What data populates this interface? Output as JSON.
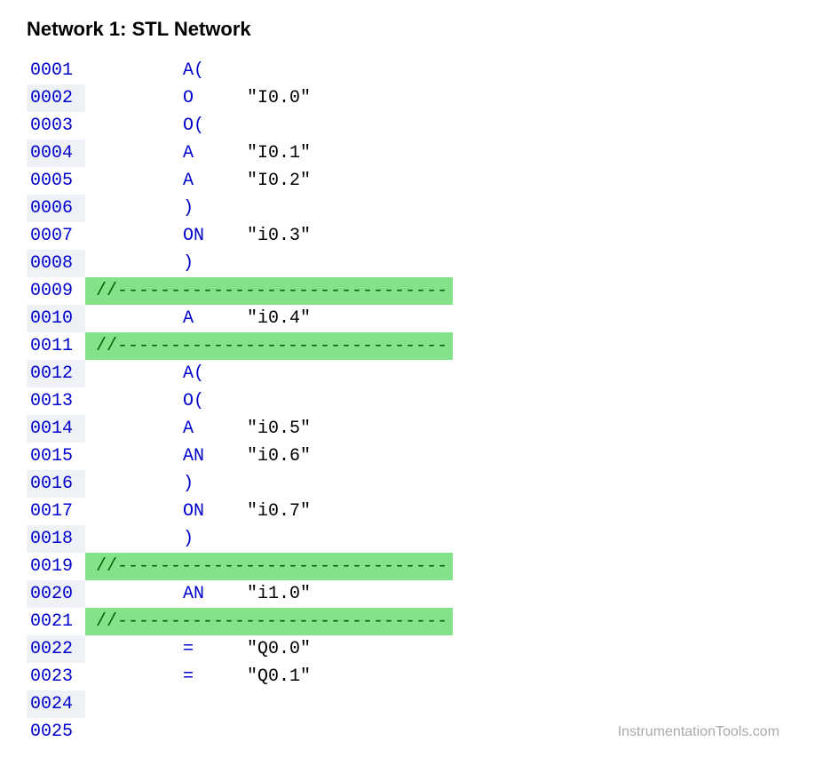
{
  "title": "Network 1: STL Network",
  "watermark": "InstrumentationTools.com",
  "comment_sep": "//-------------------------------",
  "lines": [
    {
      "n": "0001",
      "type": "code",
      "op": "A(",
      "arg": ""
    },
    {
      "n": "0002",
      "type": "code",
      "op": "O",
      "arg": "\"I0.0\""
    },
    {
      "n": "0003",
      "type": "code",
      "op": "O(",
      "arg": ""
    },
    {
      "n": "0004",
      "type": "code",
      "op": "A",
      "arg": "\"I0.1\""
    },
    {
      "n": "0005",
      "type": "code",
      "op": "A",
      "arg": "\"I0.2\""
    },
    {
      "n": "0006",
      "type": "code",
      "op": ")",
      "arg": ""
    },
    {
      "n": "0007",
      "type": "code",
      "op": "ON",
      "arg": "\"i0.3\""
    },
    {
      "n": "0008",
      "type": "code",
      "op": ")",
      "arg": ""
    },
    {
      "n": "0009",
      "type": "comment"
    },
    {
      "n": "0010",
      "type": "code",
      "op": "A",
      "arg": "\"i0.4\""
    },
    {
      "n": "0011",
      "type": "comment"
    },
    {
      "n": "0012",
      "type": "code",
      "op": "A(",
      "arg": ""
    },
    {
      "n": "0013",
      "type": "code",
      "op": "O(",
      "arg": ""
    },
    {
      "n": "0014",
      "type": "code",
      "op": "A",
      "arg": "\"i0.5\""
    },
    {
      "n": "0015",
      "type": "code",
      "op": "AN",
      "arg": "\"i0.6\""
    },
    {
      "n": "0016",
      "type": "code",
      "op": ")",
      "arg": ""
    },
    {
      "n": "0017",
      "type": "code",
      "op": "ON",
      "arg": "\"i0.7\""
    },
    {
      "n": "0018",
      "type": "code",
      "op": ")",
      "arg": ""
    },
    {
      "n": "0019",
      "type": "comment"
    },
    {
      "n": "0020",
      "type": "code",
      "op": "AN",
      "arg": "\"i1.0\""
    },
    {
      "n": "0021",
      "type": "comment"
    },
    {
      "n": "0022",
      "type": "code",
      "op": "=",
      "arg": "\"Q0.0\""
    },
    {
      "n": "0023",
      "type": "code",
      "op": "=",
      "arg": "\"Q0.1\""
    },
    {
      "n": "0024",
      "type": "blank"
    },
    {
      "n": "0025",
      "type": "blank"
    }
  ]
}
